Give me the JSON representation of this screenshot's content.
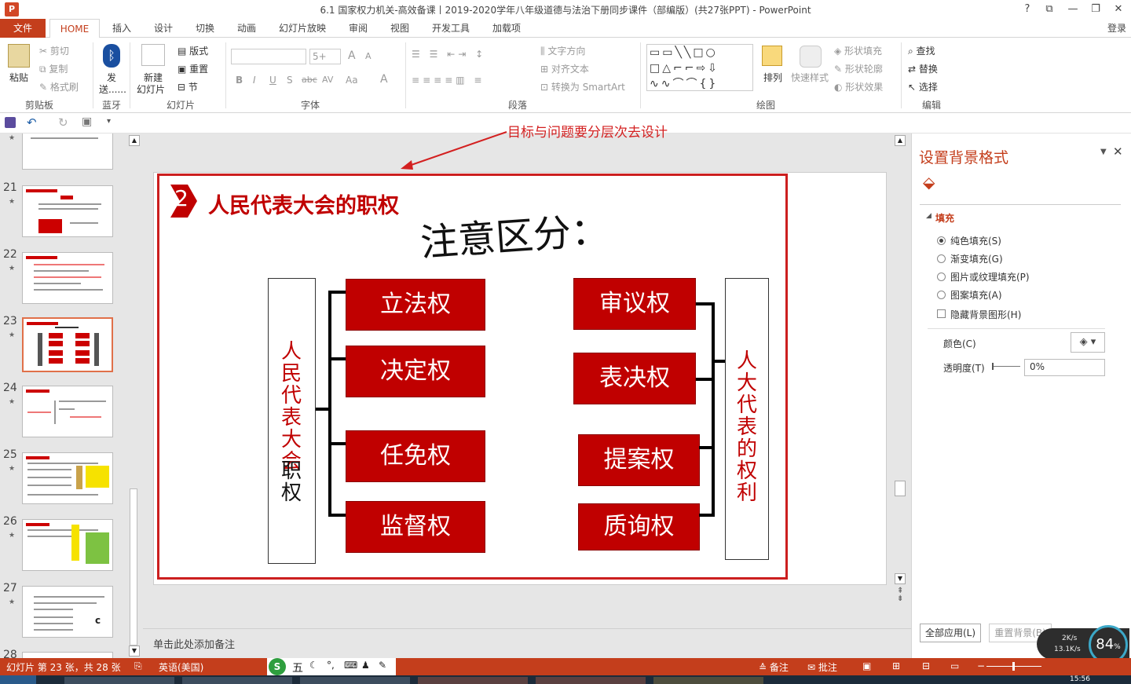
{
  "window": {
    "title": "6.1 国家权力机关-高效备课丨2019-2020学年八年级道德与法治下册同步课件（部编版）(共27张PPT) - PowerPoint",
    "logo": "P",
    "help": "?",
    "ribbon_opts": "⧉",
    "minimize": "—",
    "restore": "❐",
    "close": "✕"
  },
  "tabs": {
    "file": "文件",
    "items": [
      "HOME",
      "插入",
      "设计",
      "切换",
      "动画",
      "幻灯片放映",
      "审阅",
      "视图",
      "开发工具",
      "加载项"
    ],
    "login": "登录"
  },
  "ribbon": {
    "clipboard": {
      "paste": "粘贴",
      "cut": "剪切",
      "copy": "复制",
      "format_painter": "格式刷",
      "label": "剪贴板"
    },
    "bluetooth": {
      "send": "发",
      "send2": "送......",
      "label": "蓝牙"
    },
    "slides": {
      "new": "新建",
      "new2": "幻灯片",
      "layout": "版式",
      "reset": "重置",
      "section": "节",
      "label": "幻灯片"
    },
    "font": {
      "size": "5+",
      "bold": "B",
      "italic": "I",
      "underline": "U",
      "shadow": "S",
      "strike": "abc",
      "spacing": "AV",
      "case": "Aa",
      "color": "A",
      "grow": "A",
      "shrink": "A",
      "label": "字体"
    },
    "paragraph": {
      "text_direction": "文字方向",
      "align_text": "对齐文本",
      "smartart": "转换为 SmartArt",
      "label": "段落"
    },
    "drawing": {
      "arrange": "排列",
      "quick_styles": "快速样式",
      "shape_fill": "形状填充",
      "shape_outline": "形状轮廓",
      "shape_effects": "形状效果",
      "label": "绘图"
    },
    "editing": {
      "find": "查找",
      "replace": "替换",
      "select": "选择",
      "label": "编辑"
    }
  },
  "thumbnails": [
    {
      "num": "21",
      "star": "★"
    },
    {
      "num": "22",
      "star": "★"
    },
    {
      "num": "23",
      "star": "★"
    },
    {
      "num": "24",
      "star": "★"
    },
    {
      "num": "25",
      "star": "★"
    },
    {
      "num": "26",
      "star": "★"
    },
    {
      "num": "27",
      "star": "★"
    },
    {
      "num": "28",
      "star": ""
    }
  ],
  "thumb_extra": {
    "t27_c": "c"
  },
  "slide": {
    "annotation": "目标与问题要分层次去设计",
    "number": "2",
    "heading": "人民代表大会的职权",
    "subheading": "注意区分：",
    "left_boxes": [
      "立法权",
      "决定权",
      "任免权",
      "监督权"
    ],
    "right_boxes": [
      "审议权",
      "表决权",
      "提案权",
      "质询权"
    ],
    "left_vertical_red": "人民代表大会",
    "left_vertical_black": "职权",
    "right_vertical": "人大代表的权利"
  },
  "notes": {
    "placeholder": "单击此处添加备注"
  },
  "pane": {
    "title": "设置背景格式",
    "section": "填充",
    "options": [
      "纯色填充(S)",
      "渐变填充(G)",
      "图片或纹理填充(P)",
      "图案填充(A)"
    ],
    "hide_bg": "隐藏背景图形(H)",
    "color_label": "颜色(C)",
    "transparency_label": "透明度(T)",
    "transparency_value": "0%",
    "apply_all": "全部应用(L)",
    "reset_bg": "重置背景(B)"
  },
  "status": {
    "slide_info": "幻灯片 第 23 张，共 28 张",
    "language": "英语(美国)",
    "notes": "备注",
    "comments": "批注",
    "ime": "五",
    "zoom_pct": "84",
    "zoom_unit": "%",
    "net_up": "2K/s",
    "net_down": "13.1K/s",
    "clock": "15:56"
  },
  "colors": {
    "accent": "#c43e1c",
    "slide_red": "#c00000"
  }
}
